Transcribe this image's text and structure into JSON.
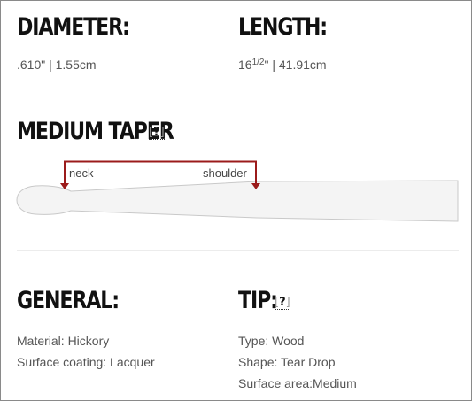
{
  "diameter": {
    "label": "DIAMETER:",
    "value": ".610\" | 1.55cm"
  },
  "length": {
    "label": "LENGTH:",
    "value_whole": "16",
    "value_fraction": "1/2",
    "value_rest": "\" | 41.91cm"
  },
  "taper": {
    "label": "MEDIUM TAPER",
    "help": "?",
    "neck_label": "neck",
    "shoulder_label": "shoulder"
  },
  "general": {
    "label": "GENERAL:",
    "lines": [
      "Material: Hickory",
      "Surface coating: Lacquer"
    ]
  },
  "tip": {
    "label": "TIP:",
    "help": "?",
    "lines": [
      "Type: Wood",
      "Shape: Tear Drop",
      "Surface area:Medium"
    ]
  },
  "colors": {
    "marker": "#9b1b1b",
    "stick_fill": "#f4f4f4",
    "stick_stroke": "#c9c9c9",
    "border": "#8a8a8a"
  }
}
